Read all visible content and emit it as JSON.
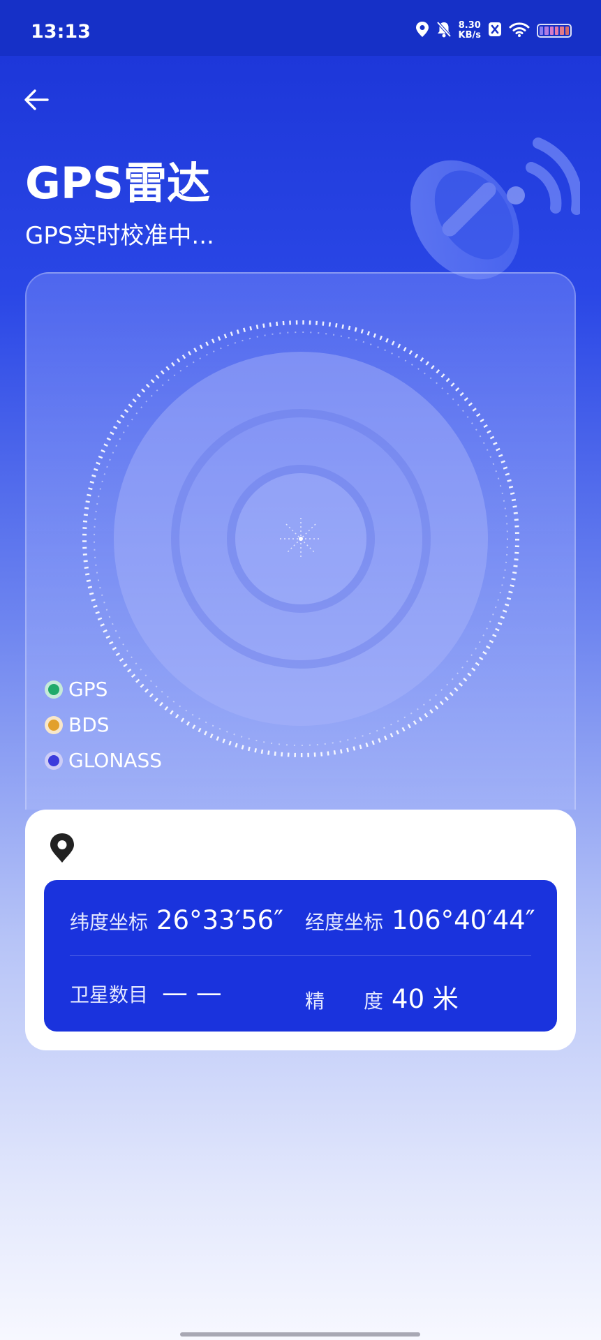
{
  "status_bar": {
    "time": "13:13",
    "speed_value": "8.30",
    "speed_unit": "KB/s"
  },
  "header": {
    "title": "GPS雷达",
    "subtitle": "GPS实时校准中..."
  },
  "legend": [
    {
      "label": "GPS",
      "color": "#1faa6a"
    },
    {
      "label": "BDS",
      "color": "#e2a02c"
    },
    {
      "label": "GLONASS",
      "color": "#3b3bdc"
    }
  ],
  "info": {
    "latitude_label": "纬度坐标",
    "latitude_value": "26°33′56″",
    "longitude_label": "经度坐标",
    "longitude_value": "106°40′44″",
    "satellites_label": "卫星数目",
    "satellites_value": "— —",
    "accuracy_label_1": "精",
    "accuracy_label_2": "度",
    "accuracy_value": "40 米"
  },
  "colors": {
    "primary": "#1a33dd",
    "status_bar": "#1630c7"
  }
}
